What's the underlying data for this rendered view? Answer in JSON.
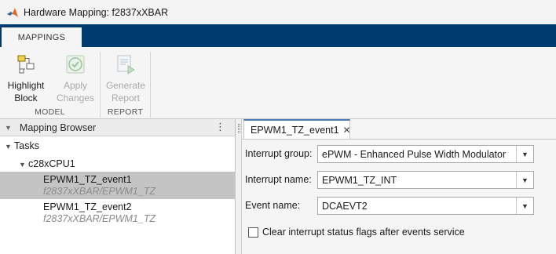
{
  "window": {
    "title": "Hardware Mapping: f2837xXBAR"
  },
  "ribbon": {
    "active_tab": "MAPPINGS"
  },
  "toolstrip": {
    "model_section": "MODEL",
    "report_section": "REPORT",
    "highlight_block": [
      "Highlight",
      "Block"
    ],
    "apply_changes": [
      "Apply",
      "Changes"
    ],
    "generate_report": [
      "Generate",
      "Report"
    ]
  },
  "browser": {
    "title": "Mapping Browser",
    "menu_glyph": "⋮",
    "tree": {
      "root": "Tasks",
      "cpu": "c28xCPU1",
      "events": [
        {
          "name": "EPWM1_TZ_event1",
          "path": "f2837xXBAR/EPWM1_TZ",
          "selected": true
        },
        {
          "name": "EPWM1_TZ_event2",
          "path": "f2837xXBAR/EPWM1_TZ",
          "selected": false
        }
      ]
    }
  },
  "editor": {
    "tab_label": "EPWM1_TZ_event1",
    "fields": {
      "interrupt_group": {
        "label": "Interrupt group:",
        "value": "ePWM - Enhanced Pulse Width Modulator"
      },
      "interrupt_name": {
        "label": "Interrupt name:",
        "value": "EPWM1_TZ_INT"
      },
      "event_name": {
        "label": "Event name:",
        "value": "DCAEVT2"
      }
    },
    "clear_flags": {
      "label": "Clear interrupt status flags after events service",
      "checked": false
    }
  },
  "colors": {
    "ribbon_bar": "#003b6f",
    "selection": "#c4c4c4",
    "tab_accent": "#4d7ab2"
  },
  "icons": [
    "matlab-logo-icon",
    "highlight-block-icon",
    "apply-changes-icon",
    "generate-report-icon",
    "close-icon",
    "chevron-down-icon",
    "kebab-menu-icon"
  ]
}
